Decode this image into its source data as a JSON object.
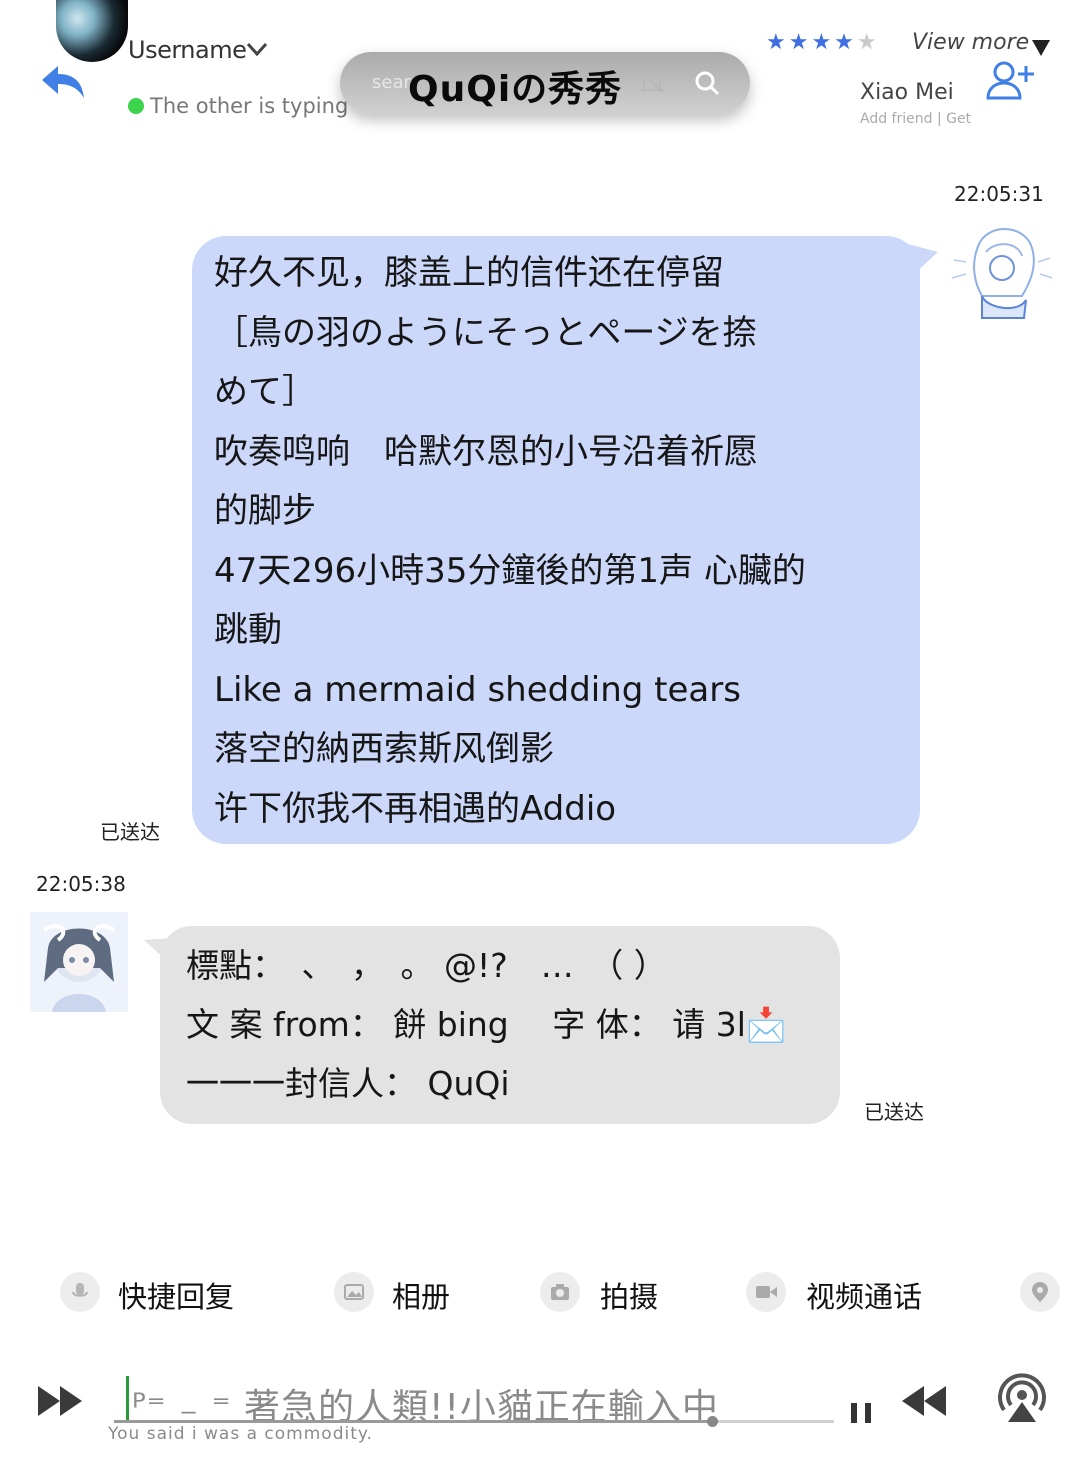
{
  "header": {
    "username": "Username",
    "typing_status": "The other is typing",
    "search_placeholder": "sear",
    "chat_title": "QuQiの秀秀",
    "rating_filled": "★★★★",
    "rating_empty": "★",
    "view_more": "View more",
    "contact_name": "Xiao Mei",
    "add_friend": "Add friend | Get"
  },
  "messages": [
    {
      "time": "22:05:31",
      "side": "right",
      "lines": [
        "好久不见，膝盖上的信件还在停留",
        "［鳥の羽のようにそっとページを捺",
        "めて］",
        "吹奏鸣响　哈默尔恩的小号沿着祈愿",
        "的脚步",
        "47天296小時35分鐘後的第1声 心臟的",
        "跳動",
        "Like a mermaid shedding tears",
        "落空的納西索斯风倒影",
        "许下你我不再相遇的Addio"
      ],
      "status": "已送达"
    },
    {
      "time": "22:05:38",
      "side": "left",
      "lines": [
        "標點：　、　，　。 @!?　…　（ ）",
        "文 案 from： 餅 bing　 字 体： 请 3l📩",
        "一一一封信人： QuQi"
      ],
      "status": "已送达"
    }
  ],
  "quick_actions": [
    {
      "icon": "microphone-icon",
      "label": "快捷回复"
    },
    {
      "icon": "image-icon",
      "label": "相册"
    },
    {
      "icon": "camera-icon",
      "label": "拍摄"
    },
    {
      "icon": "video-camera-icon",
      "label": "视频通话"
    },
    {
      "icon": "location-icon",
      "label": ""
    }
  ],
  "input": {
    "text": "ᴾ⁼ ₋ ⁼ 著急的人類!!小貓正在輸入中",
    "subtitle": "You said i was a commodity.",
    "progress": 0.83
  },
  "colors": {
    "outgoing_bubble": "#ccd8fa",
    "incoming_bubble": "#e3e3e3",
    "accent_blue": "#3f6fe0",
    "online_green": "#3cd44c"
  }
}
